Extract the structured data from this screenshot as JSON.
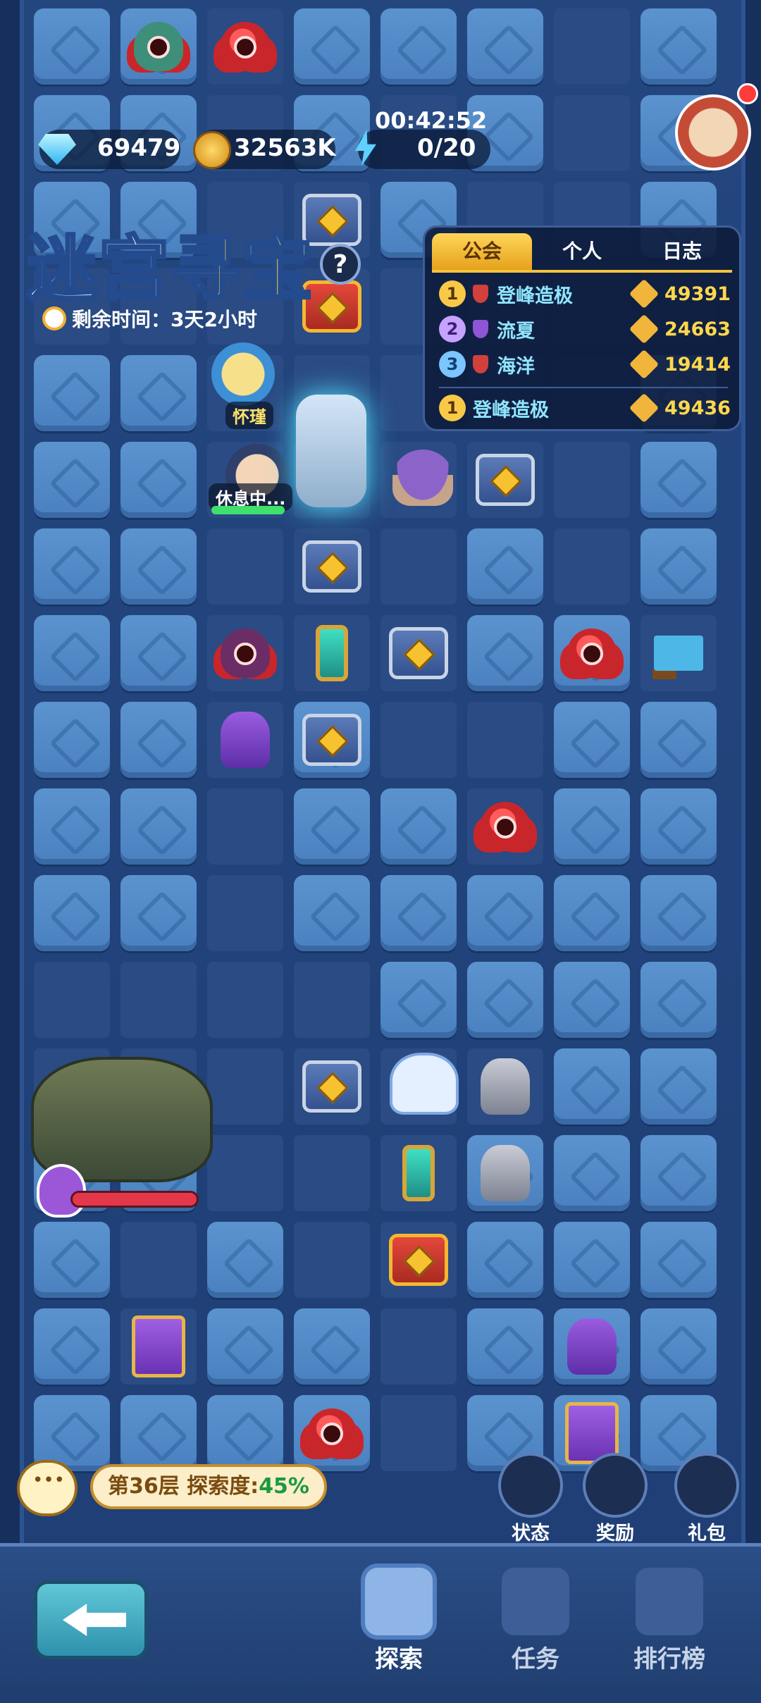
{
  "header": {
    "gems": "69479",
    "coins": "32563K",
    "energy_timer": "00:42:52",
    "energy": "0/20"
  },
  "event": {
    "title_part1": "迷宫",
    "title_part2": "寻宝",
    "remaining_label": "剩余时间：3天2小时",
    "mystery_label": "?"
  },
  "heroes": {
    "name": "怀瑾",
    "status": "休息中..."
  },
  "ranking": {
    "tabs": [
      "公会",
      "个人",
      "日志"
    ],
    "rows": [
      {
        "rank": "1",
        "name": "登峰造极",
        "score": "49391"
      },
      {
        "rank": "2",
        "name": "流夏",
        "score": "24663"
      },
      {
        "rank": "3",
        "name": "海洋",
        "score": "19414"
      }
    ],
    "own": {
      "rank": "1",
      "name": "登峰造极",
      "score": "49436"
    }
  },
  "floor": {
    "label": "第36层 探索度:",
    "progress": "45%"
  },
  "side_buttons": [
    "状态",
    "奖励",
    "礼包"
  ],
  "nav": {
    "explore": "探索",
    "tasks": "任务",
    "leaderboard": "排行榜"
  },
  "colors": {
    "board": "#24467f",
    "tile": "#5b93cf",
    "accent_gold": "#f3c33b",
    "rank_name": "#8fe6ff",
    "progress_green": "#1b9a3e"
  }
}
